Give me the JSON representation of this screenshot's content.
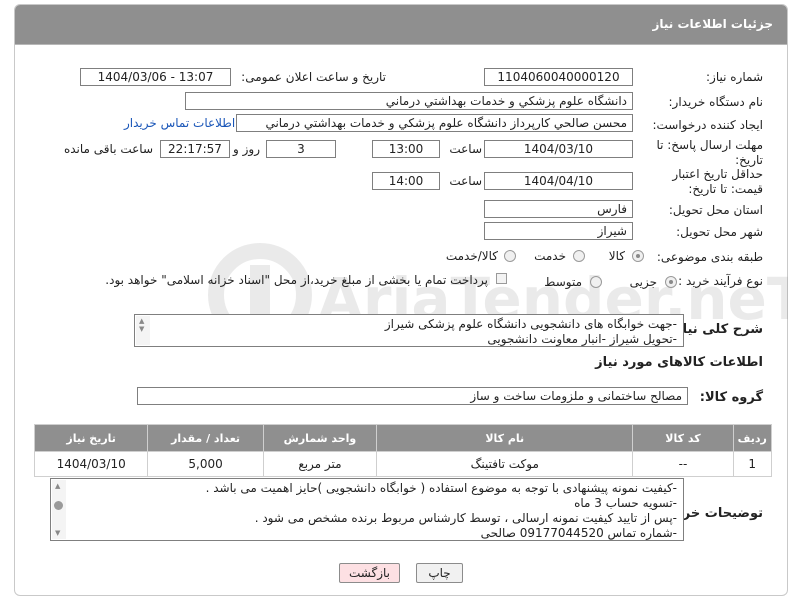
{
  "header": {
    "title": "جزئیات اطلاعات نیاز"
  },
  "fields": {
    "need_number_label": "شماره نیاز:",
    "need_number": "1104060040000120",
    "announce_label": "تاریخ و ساعت اعلان عمومی:",
    "announce_value": "1404/03/06 - 13:07",
    "buyer_org_label": "نام دستگاه خریدار:",
    "buyer_org": "دانشگاه علوم پزشكي و خدمات بهداشتي درماني",
    "creator_label": "ایجاد کننده درخواست:",
    "creator": "محسن صالحي كارپرداز دانشگاه علوم پزشكي و خدمات بهداشتي درماني",
    "buyer_contact_link": "اطلاعات تماس خریدار",
    "deadline_label": "مهلت ارسال پاسخ: تا تاریخ:",
    "deadline_date": "1404/03/10",
    "time_word": "ساعت",
    "deadline_time": "13:00",
    "remaining_days": "3",
    "day_and": "روز و",
    "remaining_time": "22:17:57",
    "remaining_suffix": "ساعت باقی مانده",
    "validity_label": "حداقل تاریخ اعتبار قیمت: تا تاریخ:",
    "validity_date": "1404/04/10",
    "validity_time": "14:00",
    "province_label": "استان محل تحویل:",
    "province": "فارس",
    "city_label": "شهر محل تحویل:",
    "city": "شیراز",
    "category_label": "طبقه بندی موضوعی:",
    "category_options": [
      "کالا",
      "خدمت",
      "کالا/خدمت"
    ],
    "process_label": "نوع فرآیند خرید :",
    "process_options": [
      "جزیی",
      "متوسط"
    ],
    "payment_note": "پرداخت تمام یا بخشی از مبلغ خرید،از محل \"اسناد خزانه اسلامی\" خواهد بود."
  },
  "description": {
    "label": "شرح کلی نیاز:",
    "lines": [
      "-جهت خوابگاه های دانشجویی دانشگاه علوم پزشکی شیراز",
      "-تحویل شیراز -انبار معاونت دانشجویی"
    ]
  },
  "goods": {
    "section_title": "اطلاعات کالاهای مورد نیاز",
    "group_label": "گروه کالا:",
    "group_value": "مصالح ساختمانی و ملزومات ساخت و ساز"
  },
  "table": {
    "headers": [
      "ردیف",
      "کد کالا",
      "نام کالا",
      "واحد شمارش",
      "تعداد / مقدار",
      "تاریخ نیاز"
    ],
    "rows": [
      [
        "1",
        "--",
        "موکت تافتینگ",
        "متر مربع",
        "5,000",
        "1404/03/10"
      ]
    ]
  },
  "buyer_notes": {
    "label": "توضیحات خریدار:",
    "lines": [
      "-کیفیت نمونه پیشنهادی با توجه به موضوع استفاده ( خوابگاه دانشجویی )حایز اهمیت می باشد .",
      "-تسویه حساب 3 ماه",
      "-پس از تایید کیفیت نمونه ارسالی ، توسط کارشناس مربوط برنده مشخص می شود .",
      "-شماره تماس 09177044520 صالحی"
    ]
  },
  "buttons": {
    "print": "چاپ",
    "back": "بازگشت"
  },
  "watermark": {
    "text": "AriaTender.neT"
  },
  "colors": {
    "header_bg": "#8f8f8f",
    "link": "#1a56b8",
    "back_button_bg": "#fde0e3"
  }
}
